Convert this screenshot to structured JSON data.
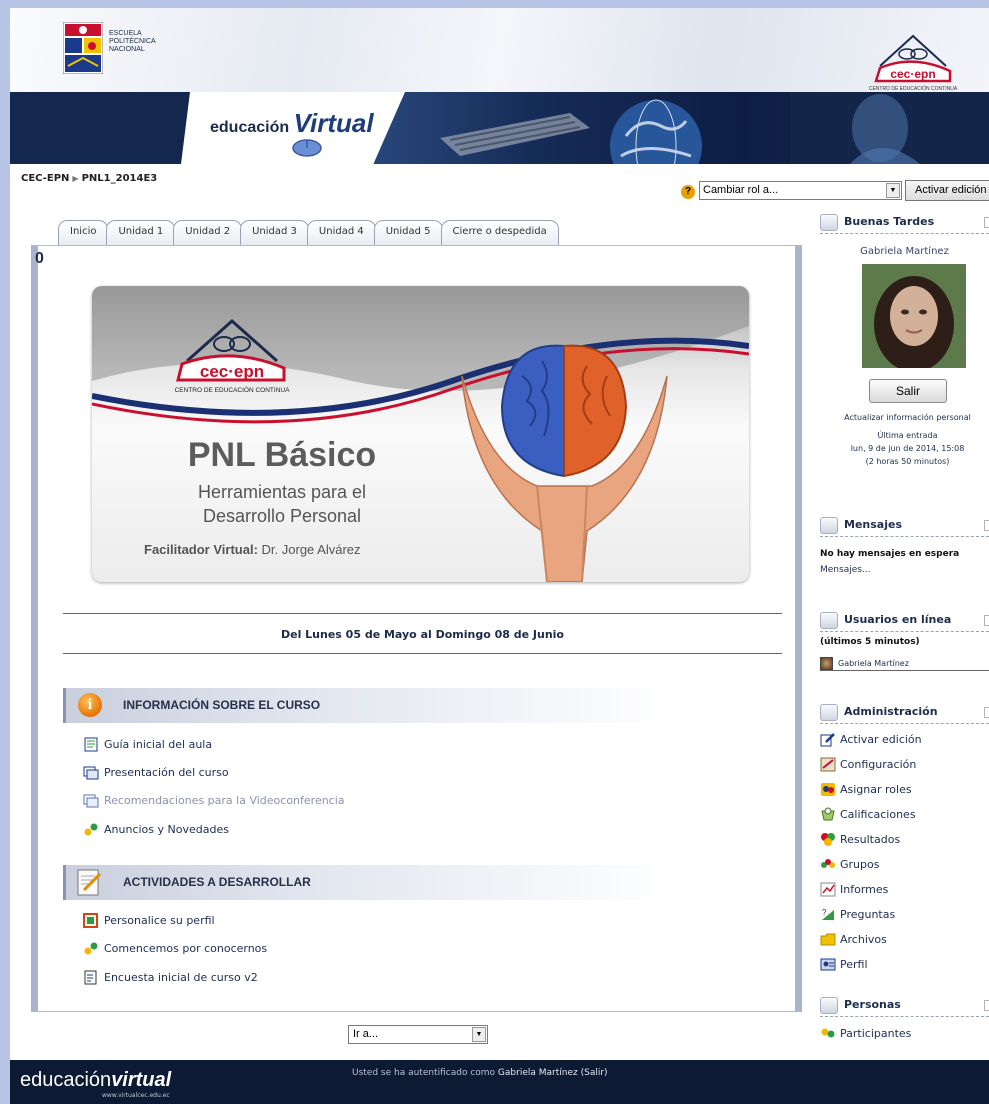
{
  "header": {
    "institution_lines": [
      "ESCUELA",
      "POLITÉCNICA",
      "NACIONAL"
    ],
    "brand_prefix": "educación",
    "brand_highlight": "Virtual"
  },
  "nav": {
    "breadcrumb": [
      "CEC-EPN",
      "PNL1_2014E3"
    ],
    "breadcrumb_separator": "▶",
    "role_select_value": "Cambiar rol a...",
    "edit_button_label": "Activar edición"
  },
  "tabs": [
    "Inicio",
    "Unidad 1",
    "Unidad 2",
    "Unidad 3",
    "Unidad 4",
    "Unidad 5",
    "Cierre o despedida"
  ],
  "main": {
    "section_number": "0",
    "banner": {
      "title": "PNL Básico",
      "subtitle_line1": "Herramientas para el",
      "subtitle_line2": "Desarrollo Personal",
      "facilitator_label": "Facilitador Virtual:",
      "facilitator_name": "Dr. Jorge Alvárez"
    },
    "date_range": "Del Lunes 05 de Mayo al Domingo 08 de Junio",
    "sections": [
      {
        "title": "INFORMACIÓN SOBRE EL CURSO",
        "icon": "info-icon",
        "items": [
          {
            "label": "Guía inicial del aula",
            "icon": "document-icon"
          },
          {
            "label": "Presentación del curso",
            "icon": "window-icon"
          },
          {
            "label": "Recomendaciones para la Videoconferencia",
            "icon": "window-icon",
            "dimmed": true
          },
          {
            "label": "Anuncios y Novedades",
            "icon": "forum-icon"
          }
        ]
      },
      {
        "title": "ACTIVIDADES A DESARROLLAR",
        "icon": "tasks-icon",
        "items": [
          {
            "label": "Personalice su perfil",
            "icon": "assignment-icon"
          },
          {
            "label": "Comencemos por conocernos",
            "icon": "forum-icon"
          },
          {
            "label": "Encuesta inicial de curso v2",
            "icon": "survey-icon"
          }
        ]
      }
    ],
    "goto_select_value": "Ir a..."
  },
  "sidebar": {
    "greeting_block": {
      "title": "Buenas Tardes",
      "user_name": "Gabriela Martínez",
      "logout_label": "Salir",
      "update_profile_link": "Actualizar información personal",
      "last_login_label": "Última entrada",
      "last_login_value": "lun, 9 de jun de 2014, 15:08",
      "last_login_ago": "(2 horas 50 minutos)"
    },
    "messages_block": {
      "title": "Mensajes",
      "empty_text": "No hay mensajes en espera",
      "link": "Mensajes..."
    },
    "online_block": {
      "title": "Usuarios en línea",
      "period": "(últimos 5 minutos)",
      "users": [
        "Gabriela Martínez"
      ]
    },
    "admin_block": {
      "title": "Administración",
      "items": [
        {
          "label": "Activar edición",
          "icon": "edit-icon"
        },
        {
          "label": "Configuración",
          "icon": "settings-icon"
        },
        {
          "label": "Asignar roles",
          "icon": "roles-icon"
        },
        {
          "label": "Calificaciones",
          "icon": "grades-icon"
        },
        {
          "label": "Resultados",
          "icon": "outcomes-icon"
        },
        {
          "label": "Grupos",
          "icon": "groups-icon"
        },
        {
          "label": "Informes",
          "icon": "reports-icon"
        },
        {
          "label": "Preguntas",
          "icon": "questions-icon"
        },
        {
          "label": "Archivos",
          "icon": "folder-icon"
        },
        {
          "label": "Perfil",
          "icon": "profile-icon"
        }
      ]
    },
    "people_block": {
      "title": "Personas",
      "items": [
        {
          "label": "Participantes",
          "icon": "participants-icon"
        }
      ]
    }
  },
  "footer": {
    "logo_prefix": "educación",
    "logo_highlight": "virtual",
    "logo_url": "www.virtualcec.edu.ec",
    "auth_prefix": "Usted se ha autentificado como",
    "auth_user": "Gabriela Martínez",
    "auth_logout": "(Salir)"
  }
}
